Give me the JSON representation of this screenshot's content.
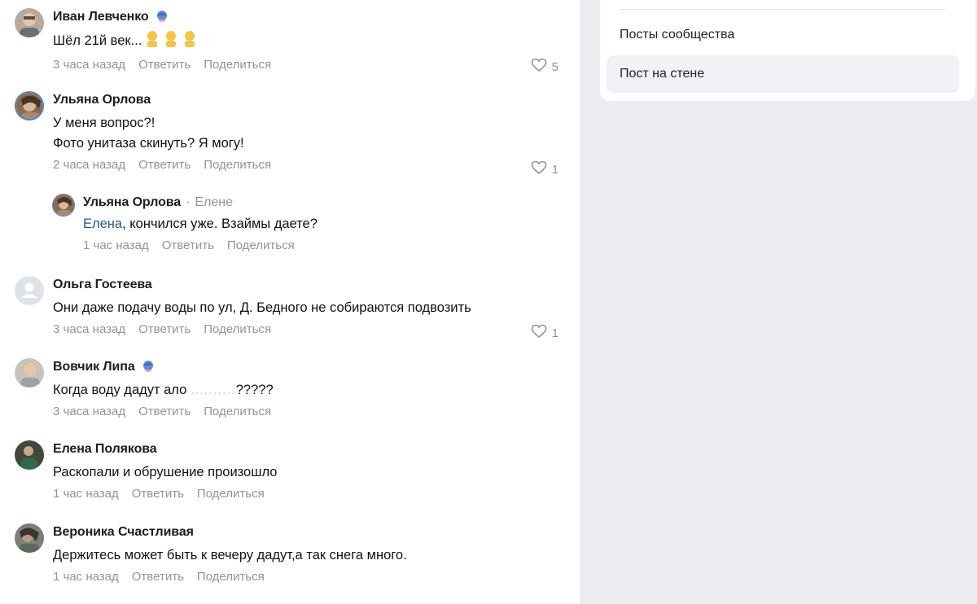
{
  "sidebar": {
    "items": [
      {
        "label": "Посты сообщества",
        "active": false
      },
      {
        "label": "Пост на стене",
        "active": true
      }
    ]
  },
  "comments": [
    {
      "author": "Иван Левченко",
      "badge": "verified-badge-icon",
      "text": "Шёл 21й век...",
      "emoji": "person-facepalm-emoji",
      "time": "3 часа назад",
      "reply": "Ответить",
      "share": "Поделиться",
      "likes": "5"
    },
    {
      "author": "Ульяна Орлова",
      "text_lines": [
        "У меня вопрос?!",
        "Фото унитаза скинуть? Я могу!"
      ],
      "time": "2 часа назад",
      "reply": "Ответить",
      "share": "Поделиться",
      "likes": "1"
    },
    {
      "author": "Ульяна Орлова",
      "to": "Елене",
      "mention": "Елена",
      "text": ", кончился уже. Взаймы даете?",
      "time": "1 час назад",
      "reply": "Ответить",
      "share": "Поделиться"
    },
    {
      "author": "Ольга Гостеева",
      "text": "Они даже подачу воды по ул, Д. Бедного не собираются подвозить",
      "time": "3 часа назад",
      "reply": "Ответить",
      "share": "Поделиться",
      "likes": "1"
    },
    {
      "author": "Вовчик Липа",
      "badge": "verified-badge-icon",
      "text": "Когда воду дадут ало",
      "blurred": "..........",
      "text_end": "?????",
      "time": "3 часа назад",
      "reply": "Ответить",
      "share": "Поделиться"
    },
    {
      "author": "Елена Полякова",
      "text": "Раскопали и обрушение произошло",
      "time": "1 час назад",
      "reply": "Ответить",
      "share": "Поделиться"
    },
    {
      "author": "Вероника Счастливая",
      "text": "Держитесь может быть к вечеру дадут,а так снега много.",
      "time": "1 час назад",
      "reply": "Ответить",
      "share": "Поделиться"
    }
  ],
  "colors": {
    "mention": "#2a5885",
    "muted": "#939393",
    "page_bg": "#ebedf0",
    "active_item": "#f0f2f5"
  }
}
